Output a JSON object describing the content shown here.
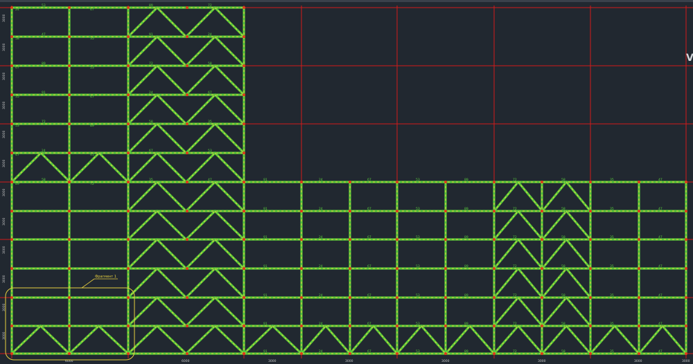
{
  "window": {
    "title": "",
    "side_letter": "V"
  },
  "drawing": {
    "callout_label": "Фрагмент 1",
    "bottom_dimensions": [
      "6000",
      "6000",
      "3000",
      "3000",
      "3000",
      "3000",
      "3000",
      "3000"
    ],
    "left_dimensions": [
      "3000",
      "3000",
      "3000",
      "3000",
      "3000",
      "3000",
      "3000",
      "3000",
      "3000",
      "3000",
      "3000",
      "3000"
    ],
    "member_labels": [
      "24",
      "67",
      "53",
      "89",
      "72",
      "58",
      "35",
      "47",
      "91"
    ],
    "colors": {
      "background": "#212830",
      "grid": "#d21a1a",
      "member": "#58c83a",
      "member_dash": "#e8d040",
      "node": "#e03a1a",
      "label": "#5ad23c",
      "callout": "#e8d040"
    },
    "layers": [
      "grid-axes",
      "structural-members",
      "nodes",
      "annotations"
    ]
  }
}
